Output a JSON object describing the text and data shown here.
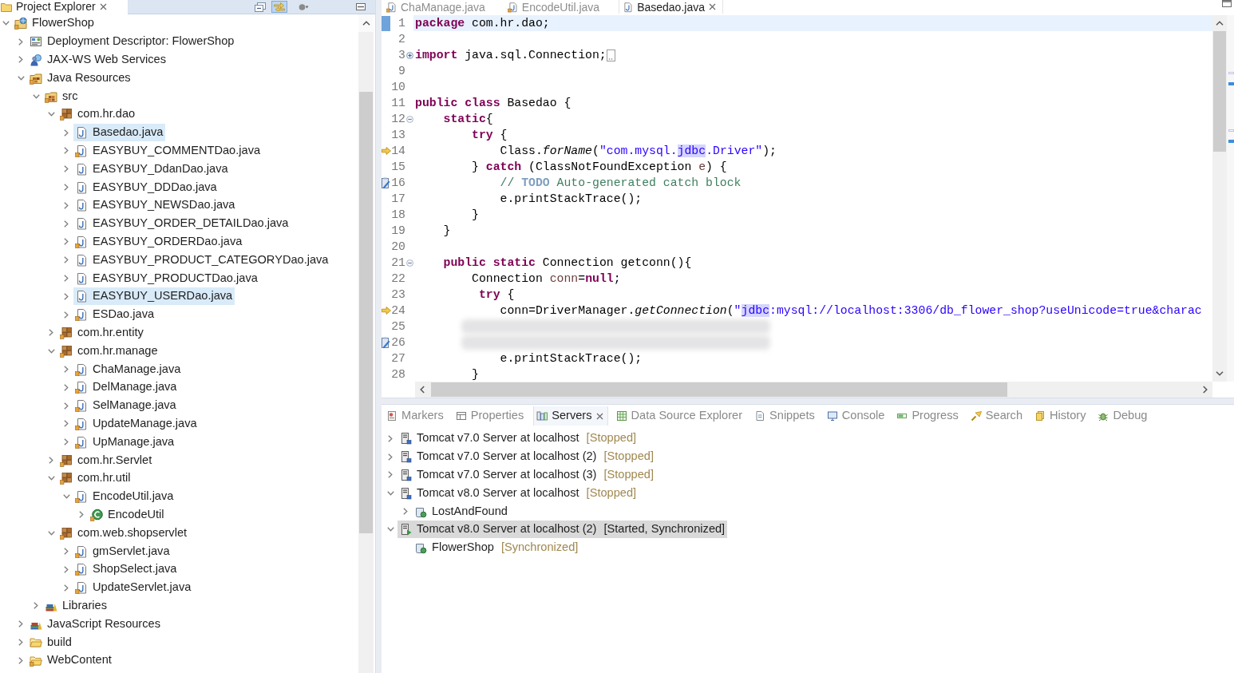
{
  "project_explorer": {
    "tabs": [
      {
        "label": "Project Explorer",
        "selected": true
      }
    ],
    "toolbar": [
      {
        "kind": "collapse-all",
        "pressed": false
      },
      {
        "kind": "link-with-editor",
        "pressed": true
      },
      {
        "kind": "view-menu",
        "pressed": false
      },
      {
        "kind": "minimize",
        "pressed": false
      }
    ],
    "tree": [
      {
        "kind": "project",
        "label": "FlowerShop",
        "expanded": true,
        "selected": false,
        "decorated": true,
        "children": [
          {
            "kind": "descriptor",
            "label": "Deployment Descriptor: FlowerShop",
            "expanded": false,
            "selected": false,
            "decorated": false
          },
          {
            "kind": "web-services",
            "label": "JAX-WS Web Services",
            "expanded": false,
            "selected": false,
            "decorated": false
          },
          {
            "kind": "java-resources",
            "label": "Java Resources",
            "expanded": true,
            "selected": false,
            "decorated": true,
            "children": [
              {
                "kind": "source-folder",
                "label": "src",
                "expanded": true,
                "selected": false,
                "decorated": true,
                "children": [
                  {
                    "kind": "package",
                    "label": "com.hr.dao",
                    "expanded": true,
                    "selected": false,
                    "decorated": true,
                    "children": [
                      {
                        "kind": "java-file",
                        "label": "Basedao.java",
                        "expanded": false,
                        "selected": true,
                        "decorated": false
                      },
                      {
                        "kind": "java-file",
                        "label": "EASYBUY_COMMENTDao.java",
                        "expanded": false,
                        "selected": false,
                        "decorated": true
                      },
                      {
                        "kind": "java-file",
                        "label": "EASYBUY_DdanDao.java",
                        "expanded": false,
                        "selected": false,
                        "decorated": false
                      },
                      {
                        "kind": "java-file",
                        "label": "EASYBUY_DDDao.java",
                        "expanded": false,
                        "selected": false,
                        "decorated": false
                      },
                      {
                        "kind": "java-file",
                        "label": "EASYBUY_NEWSDao.java",
                        "expanded": false,
                        "selected": false,
                        "decorated": false
                      },
                      {
                        "kind": "java-file",
                        "label": "EASYBUY_ORDER_DETAILDao.java",
                        "expanded": false,
                        "selected": false,
                        "decorated": false
                      },
                      {
                        "kind": "java-file",
                        "label": "EASYBUY_ORDERDao.java",
                        "expanded": false,
                        "selected": false,
                        "decorated": true
                      },
                      {
                        "kind": "java-file",
                        "label": "EASYBUY_PRODUCT_CATEGORYDao.java",
                        "expanded": false,
                        "selected": false,
                        "decorated": false
                      },
                      {
                        "kind": "java-file",
                        "label": "EASYBUY_PRODUCTDao.java",
                        "expanded": false,
                        "selected": false,
                        "decorated": false
                      },
                      {
                        "kind": "java-file",
                        "label": "EASYBUY_USERDao.java",
                        "expanded": false,
                        "selected": true,
                        "decorated": false
                      },
                      {
                        "kind": "java-file",
                        "label": "ESDao.java",
                        "expanded": false,
                        "selected": false,
                        "decorated": true
                      }
                    ]
                  },
                  {
                    "kind": "package",
                    "label": "com.hr.entity",
                    "expanded": false,
                    "selected": false,
                    "decorated": true
                  },
                  {
                    "kind": "package",
                    "label": "com.hr.manage",
                    "expanded": true,
                    "selected": false,
                    "decorated": true,
                    "children": [
                      {
                        "kind": "java-file",
                        "label": "ChaManage.java",
                        "expanded": false,
                        "selected": false,
                        "decorated": true
                      },
                      {
                        "kind": "java-file",
                        "label": "DelManage.java",
                        "expanded": false,
                        "selected": false,
                        "decorated": true
                      },
                      {
                        "kind": "java-file",
                        "label": "SelManage.java",
                        "expanded": false,
                        "selected": false,
                        "decorated": true
                      },
                      {
                        "kind": "java-file",
                        "label": "UpdateManage.java",
                        "expanded": false,
                        "selected": false,
                        "decorated": true
                      },
                      {
                        "kind": "java-file",
                        "label": "UpManage.java",
                        "expanded": false,
                        "selected": false,
                        "decorated": true
                      }
                    ]
                  },
                  {
                    "kind": "package",
                    "label": "com.hr.Servlet",
                    "expanded": false,
                    "selected": false,
                    "decorated": true
                  },
                  {
                    "kind": "package",
                    "label": "com.hr.util",
                    "expanded": true,
                    "selected": false,
                    "decorated": true,
                    "children": [
                      {
                        "kind": "java-file",
                        "label": "EncodeUtil.java",
                        "expanded": true,
                        "selected": false,
                        "decorated": true,
                        "children": [
                          {
                            "kind": "class",
                            "label": "EncodeUtil",
                            "expanded": false,
                            "selected": false,
                            "decorated": true
                          }
                        ]
                      }
                    ]
                  },
                  {
                    "kind": "package",
                    "label": "com.web.shopservlet",
                    "expanded": true,
                    "selected": false,
                    "decorated": true,
                    "children": [
                      {
                        "kind": "java-file",
                        "label": "gmServlet.java",
                        "expanded": false,
                        "selected": false,
                        "decorated": true
                      },
                      {
                        "kind": "java-file",
                        "label": "ShopSelect.java",
                        "expanded": false,
                        "selected": false,
                        "decorated": true
                      },
                      {
                        "kind": "java-file",
                        "label": "UpdateServlet.java",
                        "expanded": false,
                        "selected": false,
                        "decorated": true
                      }
                    ]
                  }
                ]
              },
              {
                "kind": "libraries",
                "label": "Libraries",
                "expanded": false,
                "selected": false,
                "decorated": false
              }
            ]
          },
          {
            "kind": "js-resources",
            "label": "JavaScript Resources",
            "expanded": false,
            "selected": false,
            "decorated": false
          },
          {
            "kind": "folder",
            "label": "build",
            "expanded": false,
            "selected": false,
            "decorated": false
          },
          {
            "kind": "folder",
            "label": "WebContent",
            "expanded": false,
            "selected": false,
            "decorated": true
          }
        ]
      }
    ]
  },
  "editor": {
    "tabs": [
      {
        "label": "ChaManage.java",
        "selected": false,
        "decorated": true
      },
      {
        "label": "EncodeUtil.java",
        "selected": false,
        "decorated": true
      },
      {
        "label": "Basedao.java",
        "selected": true,
        "decorated": false
      }
    ],
    "lines": [
      {
        "number": "1",
        "current": true,
        "blurred": false,
        "tokens": [
          {
            "kind": "keyword",
            "text": "package"
          },
          {
            "kind": "plain",
            "text": " com.hr.dao;"
          }
        ]
      },
      {
        "number": "2",
        "current": false,
        "blurred": false
      },
      {
        "number": "3",
        "current": false,
        "blurred": false,
        "fold": {
          "kind": "expand"
        },
        "tokens": [
          {
            "kind": "keyword",
            "text": "import"
          },
          {
            "kind": "plain",
            "text": " java.sql.Connection;"
          }
        ]
      },
      {
        "number": "9",
        "current": false,
        "blurred": false
      },
      {
        "number": "10",
        "current": false,
        "blurred": false
      },
      {
        "number": "11",
        "current": false,
        "blurred": false,
        "tokens": [
          {
            "kind": "keyword",
            "text": "public "
          },
          {
            "kind": "keyword",
            "text": "class"
          },
          {
            "kind": "plain",
            "text": " Basedao {"
          }
        ]
      },
      {
        "number": "12",
        "current": false,
        "blurred": false,
        "fold": {
          "kind": "collapse"
        },
        "tokens": [
          {
            "kind": "keyword",
            "text": "    static"
          },
          {
            "kind": "plain",
            "text": "{"
          }
        ]
      },
      {
        "number": "13",
        "current": false,
        "blurred": false,
        "tokens": [
          {
            "kind": "keyword",
            "text": "        try"
          },
          {
            "kind": "plain",
            "text": " {"
          }
        ]
      },
      {
        "number": "14",
        "current": false,
        "blurred": false,
        "marker": {
          "kind": "arrow"
        },
        "tokens": [
          {
            "kind": "plain",
            "text": "            Class."
          },
          {
            "kind": "static-method",
            "text": "forName"
          },
          {
            "kind": "plain",
            "text": "("
          },
          {
            "kind": "string",
            "text": "\"com.mysql."
          },
          {
            "kind": "string-highlight",
            "text": "jdbc"
          },
          {
            "kind": "string",
            "text": ".Driver\""
          },
          {
            "kind": "plain",
            "text": ");"
          }
        ]
      },
      {
        "number": "15",
        "current": false,
        "blurred": false,
        "tokens": [
          {
            "kind": "plain",
            "text": "        } "
          },
          {
            "kind": "keyword",
            "text": "catch"
          },
          {
            "kind": "plain",
            "text": " (ClassNotFoundException "
          },
          {
            "kind": "variable",
            "text": "e"
          },
          {
            "kind": "plain",
            "text": ") {"
          }
        ]
      },
      {
        "number": "16",
        "current": false,
        "blurred": false,
        "marker": {
          "kind": "task"
        },
        "tokens": [
          {
            "kind": "comment",
            "text": "            // "
          },
          {
            "kind": "todo",
            "text": "TODO"
          },
          {
            "kind": "comment",
            "text": " Auto-generated catch block"
          }
        ]
      },
      {
        "number": "17",
        "current": false,
        "blurred": false,
        "tokens": [
          {
            "kind": "plain",
            "text": "            e.printStackTrace();"
          }
        ]
      },
      {
        "number": "18",
        "current": false,
        "blurred": false,
        "tokens": [
          {
            "kind": "plain",
            "text": "        }"
          }
        ]
      },
      {
        "number": "19",
        "current": false,
        "blurred": false,
        "tokens": [
          {
            "kind": "plain",
            "text": "    }"
          }
        ]
      },
      {
        "number": "20",
        "current": false,
        "blurred": false
      },
      {
        "number": "21",
        "current": false,
        "blurred": false,
        "fold": {
          "kind": "collapse"
        },
        "tokens": [
          {
            "kind": "keyword",
            "text": "    public "
          },
          {
            "kind": "keyword",
            "text": "static"
          },
          {
            "kind": "plain",
            "text": " Connection getconn(){"
          }
        ]
      },
      {
        "number": "22",
        "current": false,
        "blurred": false,
        "tokens": [
          {
            "kind": "plain",
            "text": "        Connection "
          },
          {
            "kind": "variable",
            "text": "conn"
          },
          {
            "kind": "plain",
            "text": "="
          },
          {
            "kind": "keyword",
            "text": "null"
          },
          {
            "kind": "plain",
            "text": ";"
          }
        ]
      },
      {
        "number": "23",
        "current": false,
        "blurred": false,
        "tokens": [
          {
            "kind": "keyword",
            "text": "         try"
          },
          {
            "kind": "plain",
            "text": " {"
          }
        ]
      },
      {
        "number": "24",
        "current": false,
        "blurred": false,
        "marker": {
          "kind": "arrow"
        },
        "tokens": [
          {
            "kind": "plain",
            "text": "            conn=DriverManager."
          },
          {
            "kind": "static-method",
            "text": "getConnection"
          },
          {
            "kind": "plain",
            "text": "("
          },
          {
            "kind": "string",
            "text": "\""
          },
          {
            "kind": "string-highlight",
            "text": "jdbc"
          },
          {
            "kind": "string",
            "text": ":mysql://localhost:3306/db_flower_shop?useUnicode=true&charac"
          }
        ]
      },
      {
        "number": "25",
        "current": false,
        "blurred": true
      },
      {
        "number": "26",
        "current": false,
        "blurred": true,
        "marker": {
          "kind": "task"
        }
      },
      {
        "number": "27",
        "current": false,
        "blurred": false,
        "tokens": [
          {
            "kind": "plain",
            "text": "            e.printStackTrace();"
          }
        ]
      },
      {
        "number": "28",
        "current": false,
        "blurred": false,
        "tokens": [
          {
            "kind": "plain",
            "text": "        }"
          }
        ]
      }
    ]
  },
  "bottom_panel": {
    "tabs": [
      {
        "kind": "markers",
        "label": "Markers",
        "selected": false
      },
      {
        "kind": "properties",
        "label": "Properties",
        "selected": false
      },
      {
        "kind": "servers",
        "label": "Servers",
        "selected": true
      },
      {
        "kind": "data-source-explorer",
        "label": "Data Source Explorer",
        "selected": false
      },
      {
        "kind": "snippets",
        "label": "Snippets",
        "selected": false
      },
      {
        "kind": "console",
        "label": "Console",
        "selected": false
      },
      {
        "kind": "progress",
        "label": "Progress",
        "selected": false
      },
      {
        "kind": "search",
        "label": "Search",
        "selected": false
      },
      {
        "kind": "history",
        "label": "History",
        "selected": false
      },
      {
        "kind": "debug",
        "label": "Debug",
        "selected": false
      }
    ],
    "servers": [
      {
        "kind": "server",
        "name": "Tomcat v7.0 Server at localhost",
        "status": "[Stopped]",
        "running": false,
        "expandable": true,
        "expanded": false,
        "selected": false
      },
      {
        "kind": "server",
        "name": "Tomcat v7.0 Server at localhost (2)",
        "status": "[Stopped]",
        "running": false,
        "expandable": true,
        "expanded": false,
        "selected": false
      },
      {
        "kind": "server",
        "name": "Tomcat v7.0 Server at localhost (3)",
        "status": "[Stopped]",
        "running": false,
        "expandable": true,
        "expanded": false,
        "selected": false
      },
      {
        "kind": "server",
        "name": "Tomcat v8.0 Server at localhost",
        "status": "[Stopped]",
        "running": false,
        "expandable": true,
        "expanded": true,
        "selected": false,
        "children": [
          {
            "kind": "module",
            "name": "LostAndFound",
            "expandable": true,
            "expanded": false,
            "selected": false
          }
        ]
      },
      {
        "kind": "server",
        "name": "Tomcat v8.0 Server at localhost (2)",
        "status": "[Started, Synchronized]",
        "running": true,
        "expandable": true,
        "expanded": true,
        "selected": true,
        "children": [
          {
            "kind": "module",
            "name": "FlowerShop",
            "status": "[Synchronized]",
            "expandable": false,
            "expanded": false,
            "selected": false
          }
        ]
      }
    ]
  }
}
